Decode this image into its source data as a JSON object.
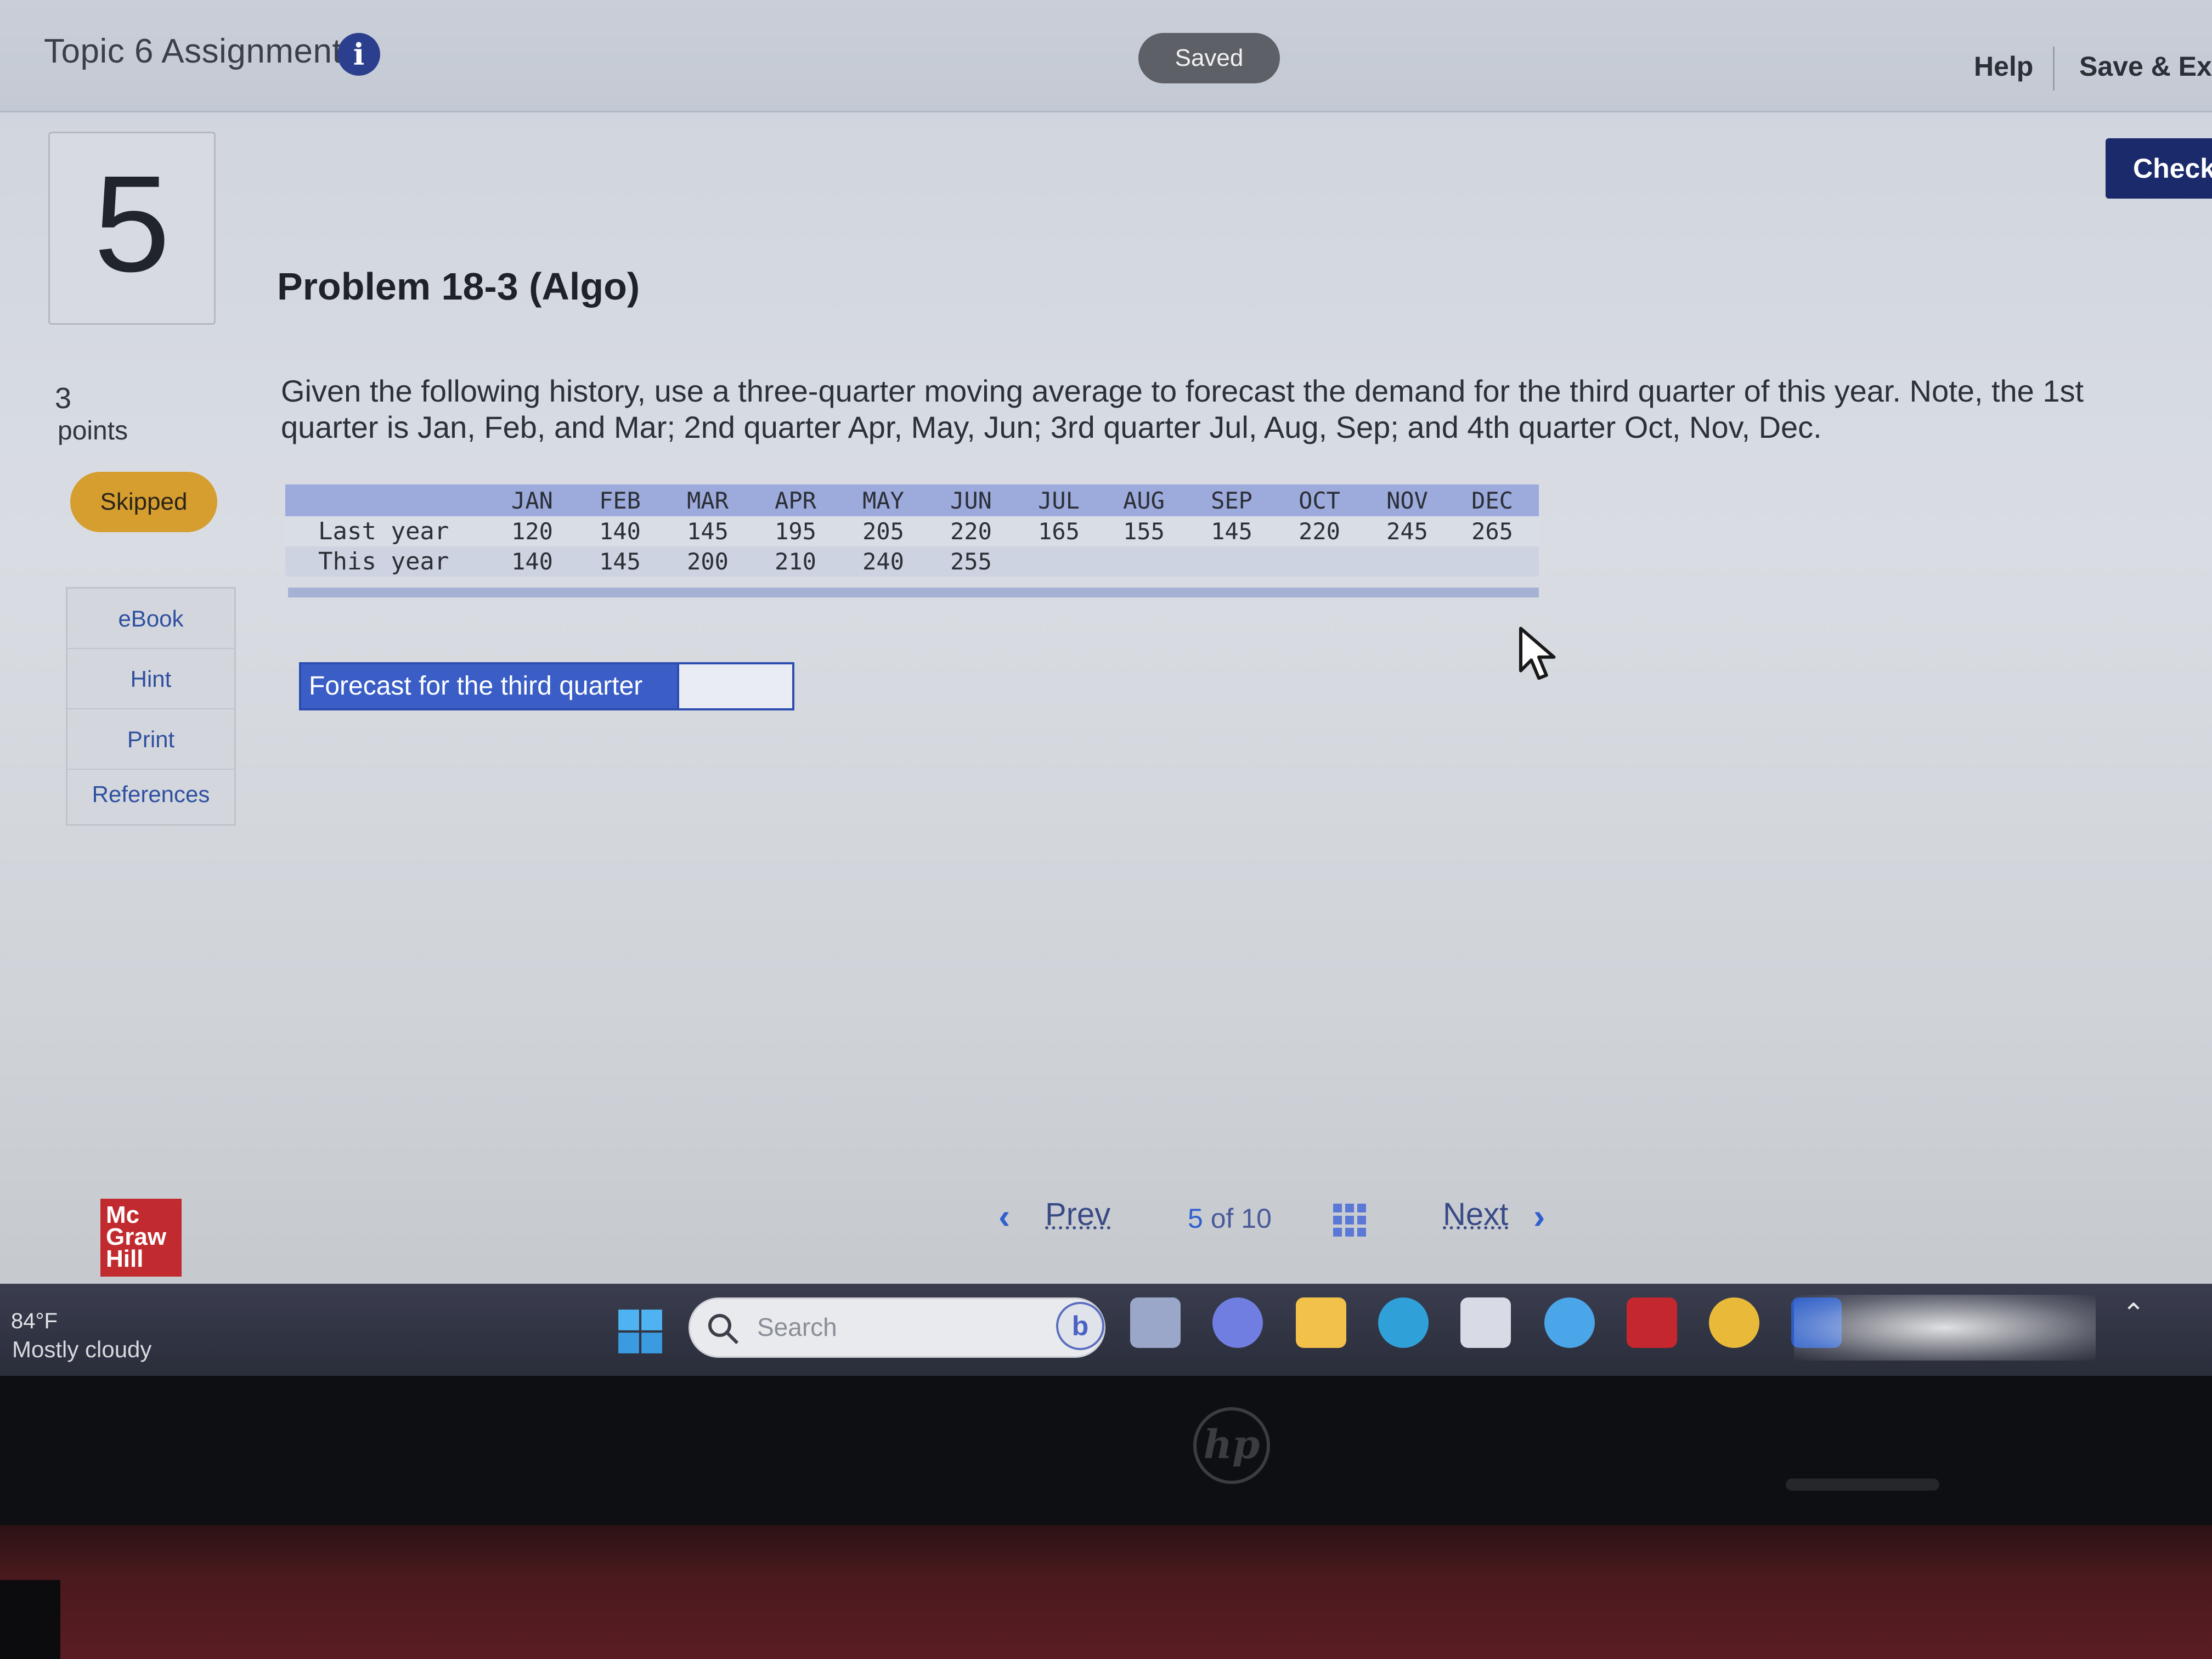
{
  "header": {
    "title": "Topic 6 Assignment",
    "status": "Saved",
    "help_label": "Help",
    "save_exit_label": "Save & Exit",
    "check_label": "Check"
  },
  "question": {
    "number": "5",
    "points_value": "3",
    "points_label": "points",
    "status_badge": "Skipped",
    "title": "Problem 18-3 (Algo)",
    "text": "Given the following history, use a three-quarter moving average to forecast the demand for the third quarter of this year. Note, the 1st quarter is Jan, Feb, and Mar; 2nd quarter Apr, May, Jun; 3rd quarter Jul, Aug, Sep; and 4th quarter Oct, Nov, Dec."
  },
  "sidebar": {
    "items": [
      {
        "label": "eBook"
      },
      {
        "label": "Hint"
      },
      {
        "label": "Print"
      },
      {
        "label": "References"
      }
    ]
  },
  "table": {
    "months": [
      "JAN",
      "FEB",
      "MAR",
      "APR",
      "MAY",
      "JUN",
      "JUL",
      "AUG",
      "SEP",
      "OCT",
      "NOV",
      "DEC"
    ],
    "rows": [
      {
        "label": "Last year",
        "values": [
          "120",
          "140",
          "145",
          "195",
          "205",
          "220",
          "165",
          "155",
          "145",
          "220",
          "245",
          "265"
        ]
      },
      {
        "label": "This year",
        "values": [
          "140",
          "145",
          "200",
          "210",
          "240",
          "255",
          "",
          "",
          "",
          "",
          "",
          ""
        ]
      }
    ]
  },
  "forecast": {
    "label": "Forecast for the third quarter",
    "value": ""
  },
  "pagination": {
    "prev_label": "Prev",
    "current": "5",
    "of_label": "of 10",
    "next_label": "Next"
  },
  "logo": {
    "line1": "Mc",
    "line2": "Graw",
    "line3": "Hill"
  },
  "taskbar": {
    "weather_temp": "84°F",
    "weather_desc": "Mostly cloudy",
    "search_placeholder": "Search"
  },
  "bezel": {
    "brand": "hp"
  },
  "colors": {
    "accent_blue": "#2e4cb0",
    "check_button": "#1b2a6b",
    "skipped_badge": "#d69d2f",
    "table_header": "#9daadc",
    "logo_red": "#c12a2e"
  },
  "icons": [
    "info-icon",
    "chevron-left-icon",
    "chevron-right-icon",
    "grid-icon",
    "cursor-icon",
    "windows-start-icon",
    "search-icon",
    "bing-icon",
    "file-explorer-icon",
    "edge-icon",
    "chrome-icon",
    "word-icon"
  ]
}
